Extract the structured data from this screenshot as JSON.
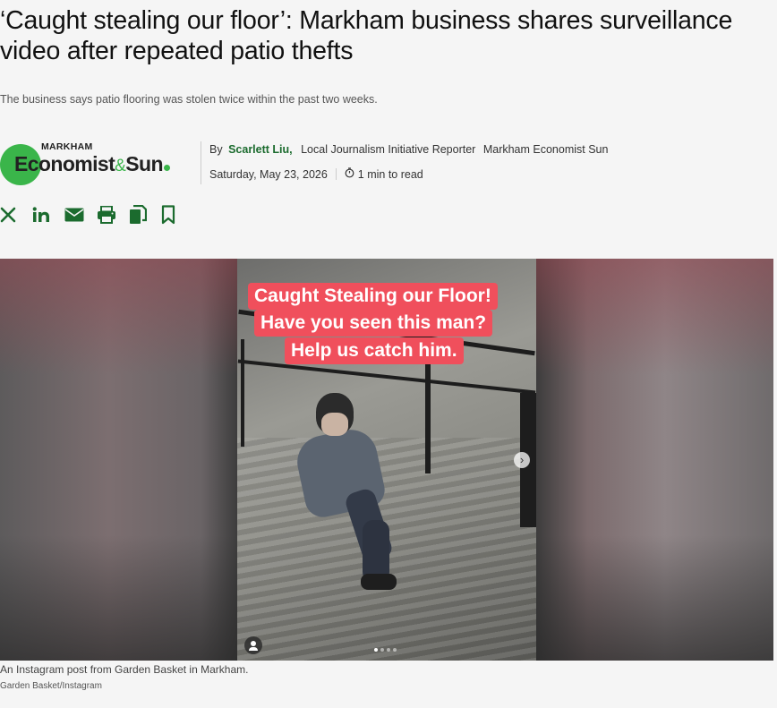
{
  "article": {
    "headline": "‘Caught stealing our floor’: Markham business shares surveillance video after repeated patio thefts",
    "subhead": "The business says patio flooring was stolen twice within the past two weeks."
  },
  "logo": {
    "small": "MARKHAM",
    "main_1": "Economist",
    "amp": "&",
    "main_2": "Sun"
  },
  "byline": {
    "prefix": "By",
    "author": "Scarlett Liu,",
    "role": "Local Journalism Initiative Reporter",
    "org": "Markham Economist Sun",
    "date": "Saturday, May 23, 2026",
    "read_time": "1 min to read"
  },
  "share": [
    {
      "name": "x-share-icon"
    },
    {
      "name": "linkedin-share-icon"
    },
    {
      "name": "email-share-icon"
    },
    {
      "name": "print-icon"
    },
    {
      "name": "copy-link-icon"
    },
    {
      "name": "bookmark-icon"
    }
  ],
  "photo": {
    "banner_1": "Caught Stealing our Floor!",
    "banner_2": "Have you seen this man?",
    "banner_3": "Help us catch him.",
    "carousel_next": "›"
  },
  "caption": {
    "text": "An Instagram post from Garden Basket in Markham.",
    "credit": "Garden Basket/Instagram"
  },
  "colors": {
    "accent_green": "#1b6b2e",
    "logo_green": "#3ab54a",
    "banner_red": "#f04f5c"
  }
}
